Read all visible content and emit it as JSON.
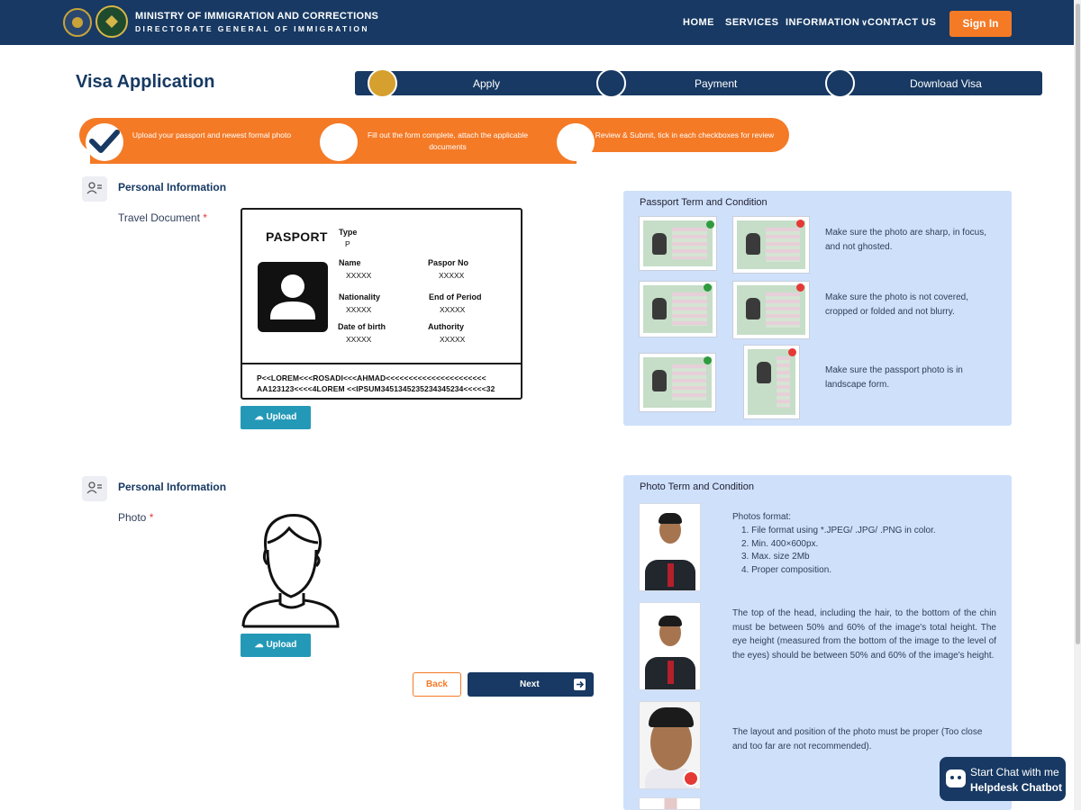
{
  "header": {
    "org_title": "MINISTRY OF IMMIGRATION AND CORRECTIONS",
    "org_subtitle": "DIRECTORATE GENERAL OF IMMIGRATION",
    "nav": {
      "home": "HOME",
      "services": "SERVICES",
      "information": "INFORMATION",
      "contact": "CONTACT US"
    },
    "sign_in": "Sign In"
  },
  "page_title": "Visa Application",
  "progress_steps": [
    {
      "label": "Apply",
      "active": true
    },
    {
      "label": "Payment",
      "active": false
    },
    {
      "label": "Download Visa",
      "active": false
    }
  ],
  "instructions": [
    "Upload your passport and newest formal photo",
    "Fill out the form complete, attach the applicable documents",
    "Review & Submit, tick in each checkboxes for review"
  ],
  "section_passport": {
    "title": "Personal Information",
    "field_label": "Travel Document",
    "required_mark": "*",
    "upload_label": "Upload"
  },
  "passport_card": {
    "title": "PASPORT",
    "type_label": "Type",
    "type_value": "P",
    "name_label": "Name",
    "name_value": "XXXXX",
    "paspor_no_label": "Paspor No",
    "paspor_no_value": "XXXXX",
    "nationality_label": "Nationality",
    "nationality_value": "XXXXX",
    "end_period_label": "End of Period",
    "end_period_value": "XXXXX",
    "dob_label": "Date of birth",
    "dob_value": "XXXXX",
    "authority_label": "Authority",
    "authority_value": "XXXXX",
    "mrz_line1": "P<<LOREM<<<ROSADI<<<AHMAD<<<<<<<<<<<<<<<<<<<<<<",
    "mrz_line2": "AA123123<<<<4LOREM <<IPSUM3451345235234345234<<<<<32"
  },
  "passport_terms": {
    "title": "Passport Term and Condition",
    "rules": [
      "Make sure the photo are sharp, in focus, and not ghosted.",
      "Make sure the photo is not covered, cropped or folded and not blurry.",
      "Make sure the passport photo is in landscape form."
    ]
  },
  "section_photo": {
    "title": "Personal Information",
    "field_label": "Photo",
    "required_mark": "*",
    "upload_label": "Upload"
  },
  "photo_terms": {
    "title": "Photo Term and Condition",
    "format_heading": "Photos format:",
    "format_items": [
      "1. File format using *.JPEG/ .JPG/ .PNG in color.",
      "2. Min. 400×600px.",
      "3. Max. size 2Mb",
      "4. Proper composition."
    ],
    "rule_head": "The top of the head, including the hair, to the bottom of the chin must be between 50% and 60% of the image's total height. The eye height (measured from the bottom of the image to the level of the eyes) should be between 50% and 60% of the image's height.",
    "rule_layout": "The layout and position of the photo must be proper (Too close and too far are not recommended)."
  },
  "buttons": {
    "back": "Back",
    "next": "Next"
  },
  "chatbot": {
    "line1": "Start Chat with me",
    "line2": "Helpdesk Chatbot"
  },
  "colors": {
    "navy": "#173963",
    "orange": "#f47a26",
    "teal": "#2499b7",
    "panel": "#cfe0fb",
    "step_active": "#d6a02e"
  }
}
